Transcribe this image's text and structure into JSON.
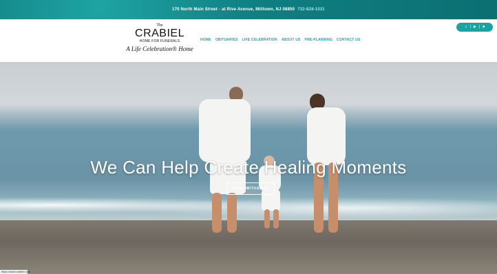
{
  "topbar": {
    "address": "170 North Main Street",
    "cross_street": "at Rive Avenue, Milltown, NJ 08850",
    "phone": "732-828-1031"
  },
  "logo": {
    "prefix": "The",
    "name": "CRABIEL",
    "subtitle": "HOME FOR FUNERALS",
    "tagline": "A Life Celebration® Home"
  },
  "nav": {
    "items": [
      "HOME",
      "OBITUARIES",
      "LIFE CELEBRATION",
      "ABOUT US",
      "PRE-PLANNING",
      "CONTACT US"
    ]
  },
  "player": {
    "music_icon": "♫",
    "sep": "|",
    "play_icon": "▶",
    "stop_icon": "■"
  },
  "hero": {
    "headline": "We Can Help Create Healing Moments",
    "button_label": "VIEW OBITUARIES"
  },
  "status_bar": {
    "url": "https://www.crabiel.com"
  }
}
